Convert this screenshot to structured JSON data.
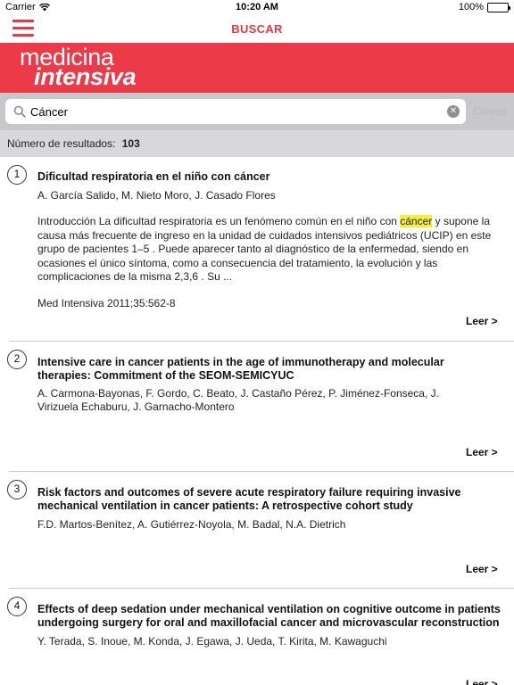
{
  "status_bar": {
    "carrier": "Carrier",
    "time": "10:20 AM",
    "battery": "100%"
  },
  "nav": {
    "title": "BUSCAR"
  },
  "brand": {
    "line1": "medicina",
    "line2": "intensiva",
    "color": "#ec3a48"
  },
  "search": {
    "value": "Cáncer",
    "cancel_label": "Cancel"
  },
  "results_summary": {
    "label": "Número de resultados:",
    "count": "103"
  },
  "results": [
    {
      "number": "1",
      "title": "Dificultad respiratoria en el niño con cáncer",
      "authors": "A. García Salido, M. Nieto Moro, J. Casado Flores",
      "abstract_before": "Introducción La dificultad respiratoria es un fenómeno común en el niño con ",
      "abstract_highlight": "cáncer",
      "abstract_after": " y supone la causa más frecuente de ingreso en la unidad de cuidados intensivos pediátricos (UCIP) en este grupo de pacientes 1–5 . Puede aparecer tanto al diagnóstico de la enfermedad, siendo en ocasiones el único síntoma, como a consecuencia del tratamiento, la evolución y las complicaciones de la misma 2,3,6 . Su ...",
      "citation": "Med Intensiva 2011;35:562-8",
      "read_label": "Leer >"
    },
    {
      "number": "2",
      "title": "Intensive care in cancer patients in the age of immunotherapy and molecular therapies: Commitment of the SEOM-SEMICYUC",
      "authors": "A. Carmona-Bayonas, F. Gordo, C. Beato, J. Castaño Pérez, P. Jiménez-Fonseca, J. Virizuela Echaburu, J. Garnacho-Montero",
      "read_label": "Leer >"
    },
    {
      "number": "3",
      "title": "Risk factors and outcomes of severe acute respiratory failure requiring invasive mechanical ventilation in cancer patients: A retrospective cohort study",
      "authors": "F.D. Martos-Benítez, A. Gutiérrez-Noyola, M. Badal, N.A. Dietrich",
      "read_label": "Leer >"
    },
    {
      "number": "4",
      "title": "Effects of deep sedation under mechanical ventilation on cognitive outcome in patients undergoing surgery for oral and maxillofacial cancer and microvascular reconstruction",
      "authors": "Y. Terada, S. Inoue, M. Konda, J. Egawa, J. Ueda, T. Kirita, M. Kawaguchi",
      "read_label": "Leer >"
    }
  ]
}
